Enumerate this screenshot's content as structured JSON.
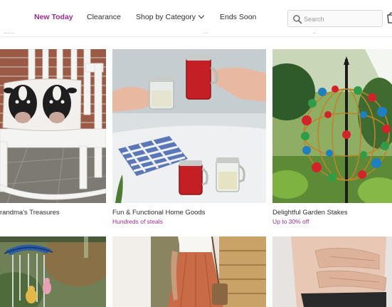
{
  "nav": {
    "items": [
      {
        "label": "New Today"
      },
      {
        "label": "Clearance"
      },
      {
        "label": "Shop by Category"
      },
      {
        "label": "Ends Soon"
      }
    ]
  },
  "search": {
    "placeholder": "Search",
    "value": ""
  },
  "icons": {
    "search": "search-icon",
    "cart": "cart-icon",
    "dropdown": "chevron-down-icon"
  },
  "colors": {
    "accent": "#9b2c8f",
    "text": "#2d2d2d",
    "border": "#d9d9d9"
  },
  "tiles": [
    {
      "title": "randma's Treasures",
      "subtitle": ""
    },
    {
      "title": "Fun & Functional Home Goods",
      "subtitle": "Hundreds of steals"
    },
    {
      "title": "Delightful Garden Stakes",
      "subtitle": "Up to 30% off"
    },
    {
      "title": "",
      "subtitle": ""
    },
    {
      "title": "",
      "subtitle": ""
    },
    {
      "title": "",
      "subtitle": ""
    }
  ]
}
